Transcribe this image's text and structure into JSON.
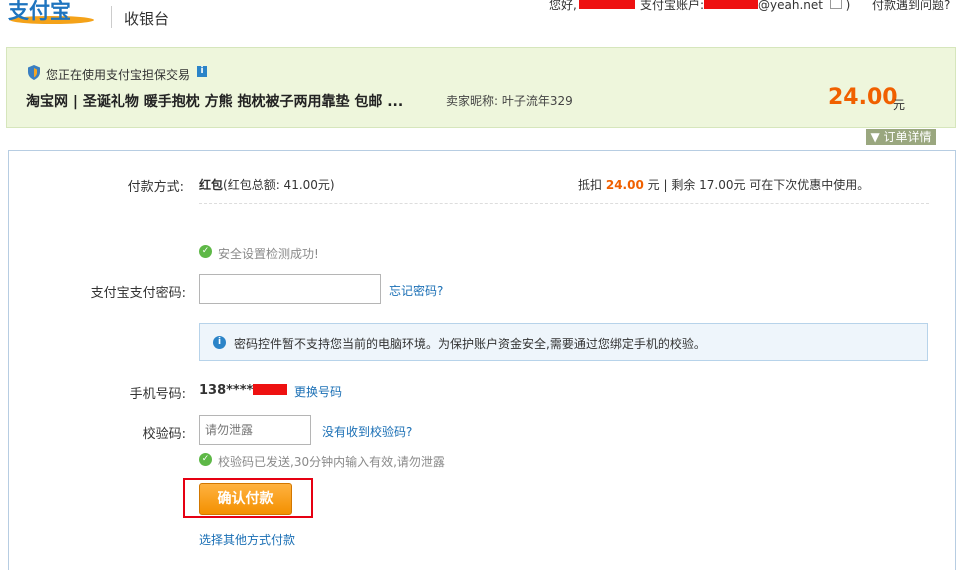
{
  "header": {
    "logo_text": "支付宝",
    "title": "收银台",
    "greeting": "您好,",
    "account_label": "支付宝账户:",
    "account_suffix": "@yeah.net",
    "close_paren": ")",
    "help_link": "付款遇到问题?"
  },
  "banner": {
    "guarantee_text": "您正在使用支付宝担保交易",
    "goods_title": "淘宝网 | 圣诞礼物 暖手抱枕 方熊 抱枕被子两用靠垫 包邮 ...",
    "seller": "卖家昵称: 叶子流年329",
    "amount": "24.00",
    "amount_unit": "元",
    "detail_tab": "订单详情"
  },
  "payment": {
    "method_label": "付款方式:",
    "method_name": "红包",
    "method_balance": "(红包总额: 41.00元)",
    "deduct_prefix": "抵扣",
    "deduct_amount": "24.00",
    "deduct_suffix": "元 | 剩余 17.00元 可在下次优惠中使用。"
  },
  "security": {
    "check_ok": "安全设置检测成功!",
    "password_label": "支付宝支付密码:",
    "forgot_password": "忘记密码?",
    "notice": "密码控件暂不支持您当前的电脑环境。为保护账户资金安全,需要通过您绑定手机的校验。",
    "phone_label": "手机号码:",
    "phone_prefix": "138****",
    "change_phone": "更换号码",
    "code_label": "校验码:",
    "code_placeholder": "请勿泄露",
    "no_code_link": "没有收到校验码?",
    "code_sent": "校验码已发送,30分钟内输入有效,请勿泄露"
  },
  "actions": {
    "confirm": "确认付款",
    "other_method": "选择其他方式付款"
  },
  "colors": {
    "accent_orange": "#f06000",
    "link_blue": "#1a6fb5",
    "banner_green": "#eef6dc",
    "redaction_red": "#ee1111"
  }
}
